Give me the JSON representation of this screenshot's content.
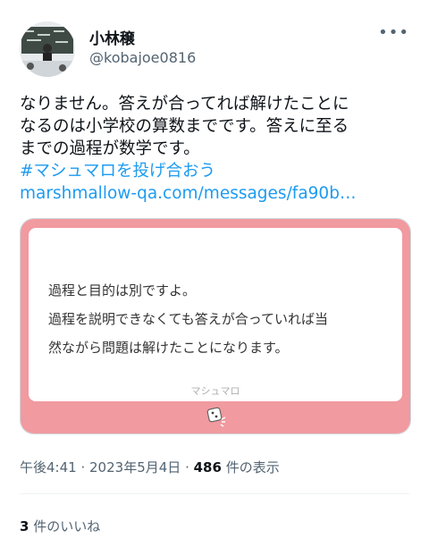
{
  "user": {
    "name": "小林穣",
    "handle": "@kobajoe0816"
  },
  "tweet": {
    "lines": [
      "なりません。答えが合ってれば解けたことに",
      "なるのは小学校の算数までです。答えに至る",
      "までの過程が数学です。"
    ],
    "hashtag": "#マシュマロを投げ合おう",
    "url": "marshmallow-qa.com/messages/fa90b…"
  },
  "card": {
    "lines": [
      "過程と目的は別ですよ。",
      "過程を説明できなくても答えが合っていれば当",
      "然ながら問題は解けたことになります。"
    ],
    "brand": "マシュマロ"
  },
  "meta": {
    "time": "午後4:41",
    "date": "2023年5月4日",
    "views_count": "486",
    "views_label": "件の表示"
  },
  "likes": {
    "count": "3",
    "label": "件のいいね"
  },
  "colors": {
    "link": "#1d9bf0",
    "card_accent": "#f19a9f"
  }
}
